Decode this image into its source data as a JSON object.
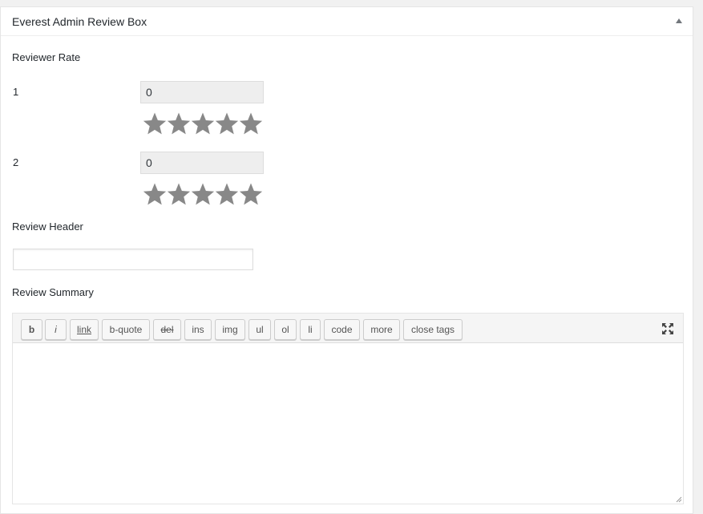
{
  "postbox": {
    "title": "Everest Admin Review Box",
    "toggle_icon": "triangle-up-icon"
  },
  "reviewer_rate": {
    "label": "Reviewer Rate",
    "items": [
      {
        "number": "1",
        "value": "0",
        "stars_total": 5,
        "stars_filled": 0
      },
      {
        "number": "2",
        "value": "0",
        "stars_total": 5,
        "stars_filled": 0
      }
    ]
  },
  "review_header": {
    "label": "Review Header",
    "value": "",
    "placeholder": ""
  },
  "review_summary": {
    "label": "Review Summary",
    "value": "",
    "toolbar": {
      "b": "b",
      "i": "i",
      "link": "link",
      "b_quote": "b-quote",
      "del": "del",
      "ins": "ins",
      "img": "img",
      "ul": "ul",
      "ol": "ol",
      "li": "li",
      "code": "code",
      "more": "more",
      "close_tags": "close tags"
    },
    "fullscreen_icon": "fullscreen-icon"
  },
  "colors": {
    "star": "#888888",
    "input_bg": "#eeeeee",
    "border": "#dddddd",
    "toolbar_bg": "#f5f5f5"
  }
}
